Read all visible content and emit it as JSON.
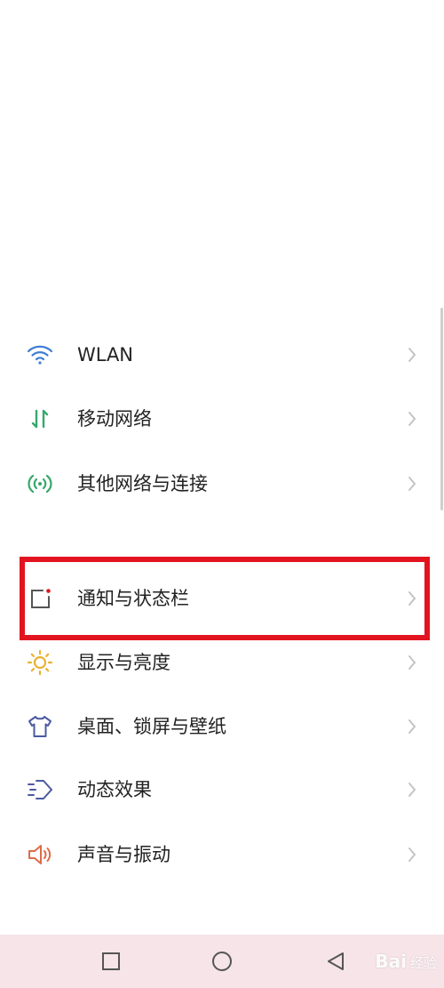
{
  "settings_list": {
    "items": [
      {
        "label": "WLAN",
        "icon": "wifi-icon",
        "color": "#3f7fd6"
      },
      {
        "label": "移动网络",
        "icon": "mobile-data-icon",
        "color": "#35a86b"
      },
      {
        "label": "其他网络与连接",
        "icon": "connection-icon",
        "color": "#35a86b"
      },
      {
        "label": "通知与状态栏",
        "icon": "notification-icon",
        "color": "#555555"
      },
      {
        "label": "显示与亮度",
        "icon": "brightness-icon",
        "color": "#e9b233"
      },
      {
        "label": "桌面、锁屏与壁纸",
        "icon": "shirt-icon",
        "color": "#4a5aa0"
      },
      {
        "label": "动态效果",
        "icon": "dynamic-effect-icon",
        "color": "#4a5aa0"
      },
      {
        "label": "声音与振动",
        "icon": "speaker-icon",
        "color": "#e06a4a"
      }
    ]
  },
  "highlight": {
    "color": "#e2141f"
  },
  "navbar": {
    "background": "#f6e4e9",
    "buttons": [
      "recent-apps-icon",
      "home-icon",
      "back-icon"
    ]
  },
  "watermark": {
    "brand": "Bai",
    "suffix": "经验"
  }
}
